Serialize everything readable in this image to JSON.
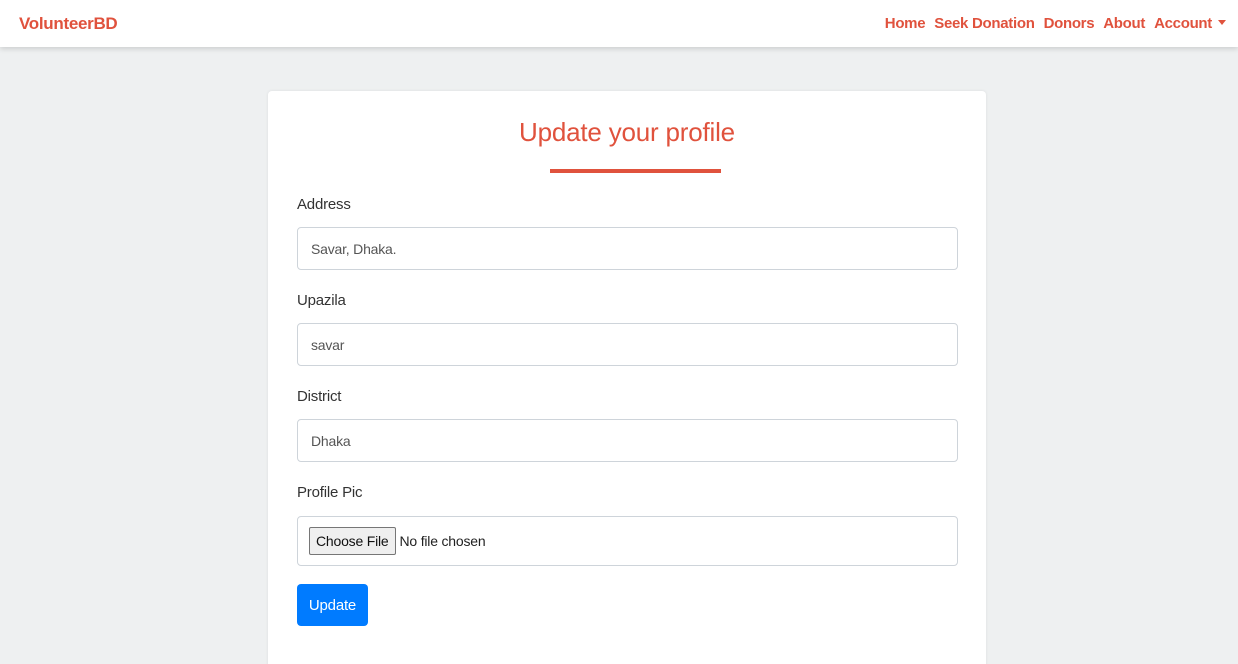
{
  "navbar": {
    "brand": "VolunteerBD",
    "links": [
      "Home",
      "Seek Donation",
      "Donors",
      "About",
      "Account"
    ]
  },
  "form": {
    "title": "Update your profile",
    "address_label": "Address",
    "address_value": "Savar, Dhaka.",
    "upazila_label": "Upazila",
    "upazila_value": "savar",
    "district_label": "District",
    "district_value": "Dhaka",
    "profile_pic_label": "Profile Pic",
    "choose_file_label": "Choose File",
    "file_status": "No file chosen",
    "submit_label": "Update"
  },
  "colors": {
    "brand": "#e0523d",
    "primary_button": "#007bff",
    "page_background": "#eef0f1"
  },
  "icons": {
    "account_dropdown": "caret-down-icon"
  }
}
